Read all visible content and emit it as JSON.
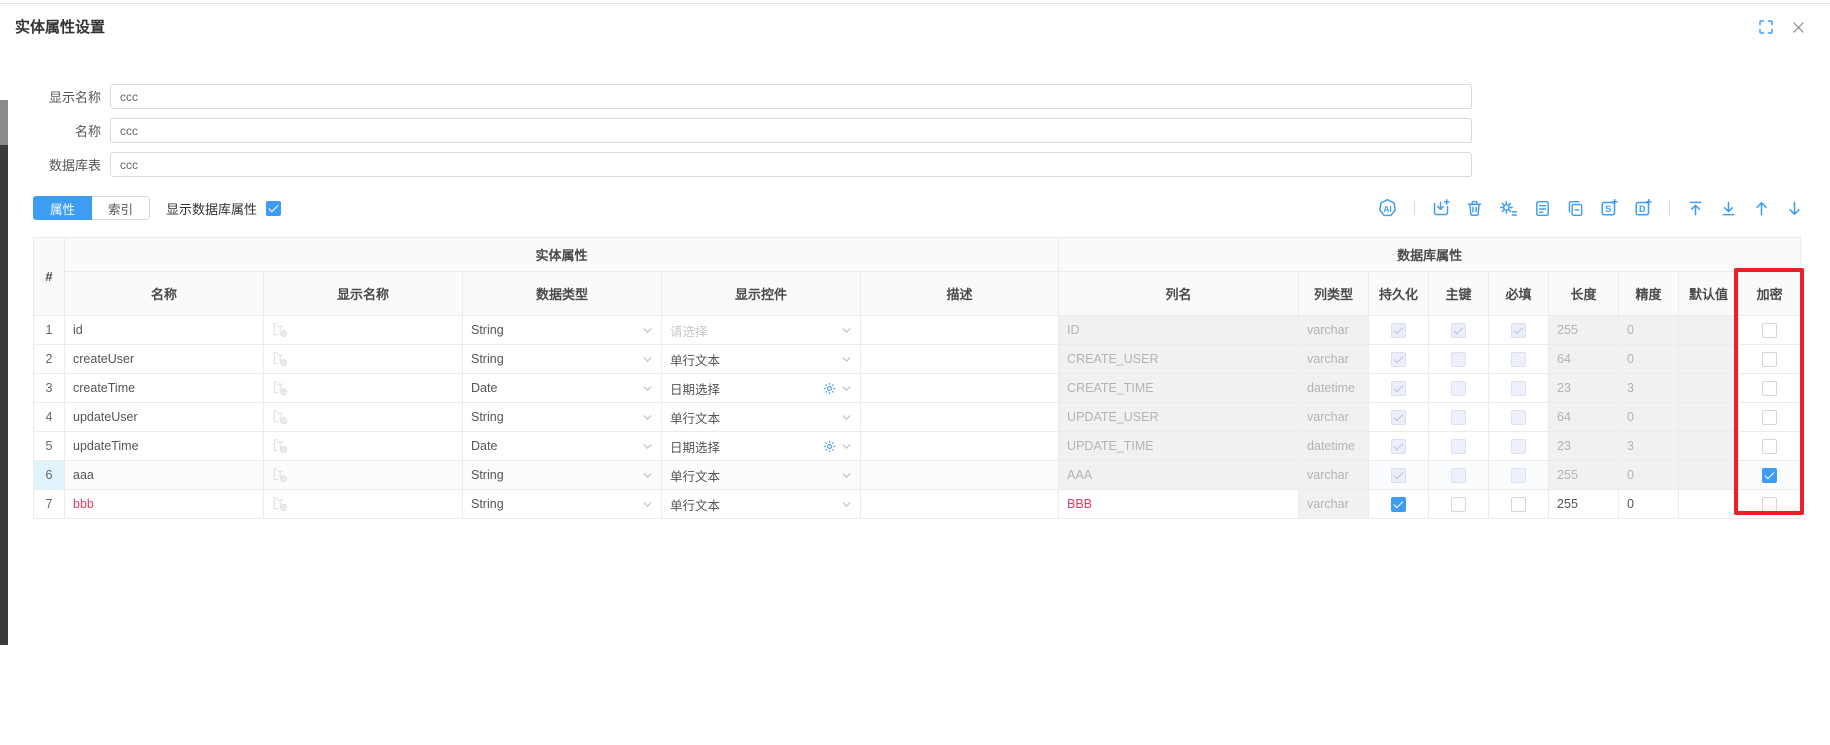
{
  "modal": {
    "title": "实体属性设置"
  },
  "window_controls": {
    "fullscreen_icon": "fullscreen",
    "close_icon": "close"
  },
  "form": {
    "fields": [
      {
        "label": "显示名称",
        "value": "ccc"
      },
      {
        "label": "名称",
        "value": "ccc"
      },
      {
        "label": "数据库表",
        "value": "ccc"
      }
    ]
  },
  "tabs": [
    {
      "label": "属性",
      "active": true
    },
    {
      "label": "索引",
      "active": false
    }
  ],
  "show_db": {
    "label": "显示数据库属性",
    "checked": true
  },
  "toolbar": {
    "icons": [
      "ai-icon",
      "divider",
      "insert-row-icon",
      "delete-icon",
      "settings-list-icon",
      "document-icon",
      "copy-icon",
      "add-s-icon",
      "add-d-icon",
      "divider",
      "move-top-icon",
      "move-bottom-icon",
      "move-up-icon",
      "move-down-icon"
    ]
  },
  "table": {
    "corner": "#",
    "groups": [
      "实体属性",
      "数据库属性"
    ],
    "columns": [
      "名称",
      "显示名称",
      "数据类型",
      "显示控件",
      "描述",
      "列名",
      "列类型",
      "持久化",
      "主键",
      "必填",
      "长度",
      "精度",
      "默认值",
      "加密"
    ],
    "rows": [
      {
        "num": "1",
        "name": "id",
        "name_red": false,
        "data_type": "String",
        "control": "请选择",
        "control_placeholder": true,
        "control_gear": false,
        "description": "",
        "col_name": "ID",
        "col_name_red": false,
        "col_name_readonly": true,
        "col_type": "varchar",
        "persist": "dis-checked",
        "primary_key": "dis-checked",
        "required": "dis-checked",
        "length": "255",
        "length_readonly": true,
        "precision": "0",
        "precision_readonly": true,
        "default_value": "",
        "default_readonly": true,
        "encrypt": "en-unchecked",
        "selected": false
      },
      {
        "num": "2",
        "name": "createUser",
        "name_red": false,
        "data_type": "String",
        "control": "单行文本",
        "control_placeholder": false,
        "control_gear": false,
        "description": "",
        "col_name": "CREATE_USER",
        "col_name_red": false,
        "col_name_readonly": true,
        "col_type": "varchar",
        "persist": "dis-checked",
        "primary_key": "dis-unchecked",
        "required": "dis-unchecked",
        "length": "64",
        "length_readonly": true,
        "precision": "0",
        "precision_readonly": true,
        "default_value": "",
        "default_readonly": true,
        "encrypt": "en-unchecked",
        "selected": false
      },
      {
        "num": "3",
        "name": "createTime",
        "name_red": false,
        "data_type": "Date",
        "control": "日期选择",
        "control_placeholder": false,
        "control_gear": true,
        "description": "",
        "col_name": "CREATE_TIME",
        "col_name_red": false,
        "col_name_readonly": true,
        "col_type": "datetime",
        "persist": "dis-checked",
        "primary_key": "dis-unchecked",
        "required": "dis-unchecked",
        "length": "23",
        "length_readonly": true,
        "precision": "3",
        "precision_readonly": true,
        "default_value": "",
        "default_readonly": true,
        "encrypt": "en-unchecked",
        "selected": false
      },
      {
        "num": "4",
        "name": "updateUser",
        "name_red": false,
        "data_type": "String",
        "control": "单行文本",
        "control_placeholder": false,
        "control_gear": false,
        "description": "",
        "col_name": "UPDATE_USER",
        "col_name_red": false,
        "col_name_readonly": true,
        "col_type": "varchar",
        "persist": "dis-checked",
        "primary_key": "dis-unchecked",
        "required": "dis-unchecked",
        "length": "64",
        "length_readonly": true,
        "precision": "0",
        "precision_readonly": true,
        "default_value": "",
        "default_readonly": true,
        "encrypt": "en-unchecked",
        "selected": false
      },
      {
        "num": "5",
        "name": "updateTime",
        "name_red": false,
        "data_type": "Date",
        "control": "日期选择",
        "control_placeholder": false,
        "control_gear": true,
        "description": "",
        "col_name": "UPDATE_TIME",
        "col_name_red": false,
        "col_name_readonly": true,
        "col_type": "datetime",
        "persist": "dis-checked",
        "primary_key": "dis-unchecked",
        "required": "dis-unchecked",
        "length": "23",
        "length_readonly": true,
        "precision": "3",
        "precision_readonly": true,
        "default_value": "",
        "default_readonly": true,
        "encrypt": "en-unchecked",
        "selected": false
      },
      {
        "num": "6",
        "name": "aaa",
        "name_red": false,
        "data_type": "String",
        "control": "单行文本",
        "control_placeholder": false,
        "control_gear": false,
        "description": "",
        "col_name": "AAA",
        "col_name_red": false,
        "col_name_readonly": true,
        "col_type": "varchar",
        "persist": "dis-checked",
        "primary_key": "dis-unchecked",
        "required": "dis-unchecked",
        "length": "255",
        "length_readonly": true,
        "precision": "0",
        "precision_readonly": true,
        "default_value": "",
        "default_readonly": true,
        "encrypt": "en-checked",
        "selected": true
      },
      {
        "num": "7",
        "name": "bbb",
        "name_red": true,
        "data_type": "String",
        "control": "单行文本",
        "control_placeholder": false,
        "control_gear": false,
        "description": "",
        "col_name": "BBB",
        "col_name_red": true,
        "col_name_readonly": false,
        "col_type": "varchar",
        "persist": "en-checked",
        "primary_key": "en-unchecked",
        "required": "en-unchecked",
        "length": "255",
        "length_readonly": false,
        "precision": "0",
        "precision_readonly": false,
        "default_value": "",
        "default_readonly": false,
        "encrypt": "en-unchecked",
        "selected": false
      }
    ]
  },
  "annotation": {
    "type": "red-box",
    "column": "加密"
  },
  "colors": {
    "accent": "#3d9cf4",
    "annotation_red": "#ee1e26",
    "row_highlight": "#e1f3fd",
    "readonly_bg": "#f1f1f1",
    "error_text": "#e23b63"
  }
}
